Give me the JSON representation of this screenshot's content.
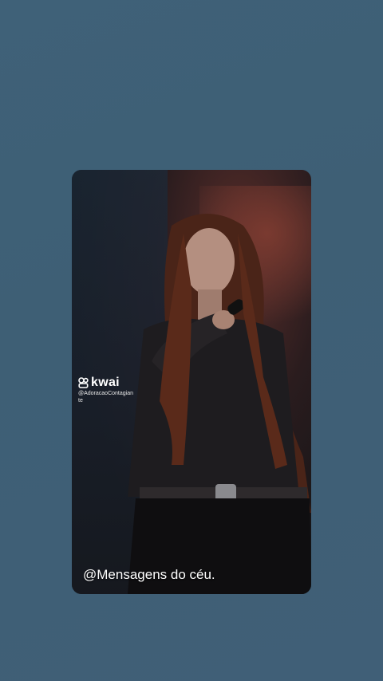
{
  "watermark": {
    "brand": "kwai",
    "handle": "@AdoracaoContagiante"
  },
  "caption": "@Mensagens do céu.",
  "colors": {
    "background": "#3e5f75",
    "text": "#ffffff"
  }
}
